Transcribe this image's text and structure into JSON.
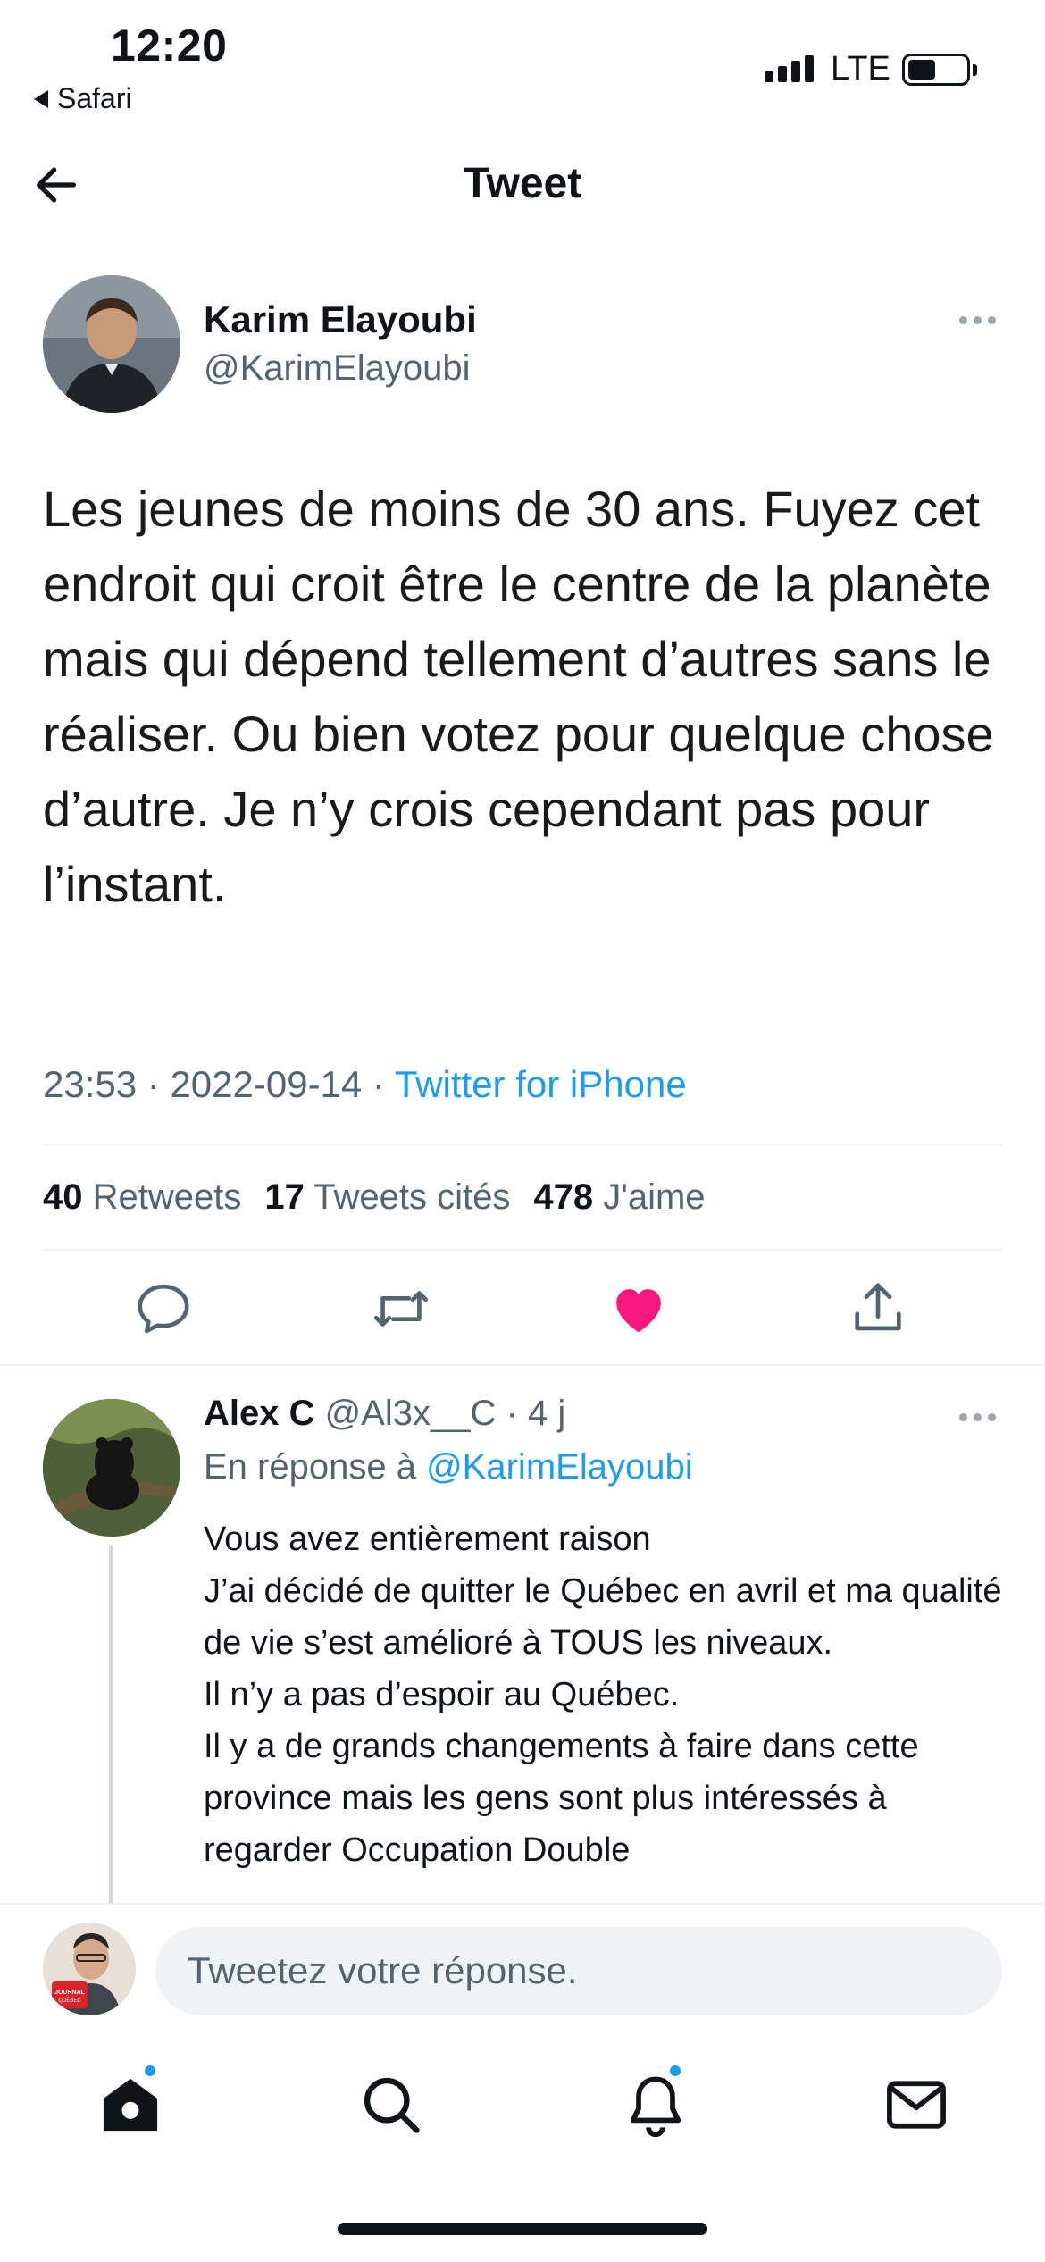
{
  "status_bar": {
    "time": "12:20",
    "back_app": "Safari",
    "network": "LTE"
  },
  "nav": {
    "title": "Tweet"
  },
  "tweet": {
    "author_name": "Karim Elayoubi",
    "author_handle": "@KarimElayoubi",
    "text": "Les jeunes de moins de 30 ans. Fuyez cet endroit qui croit être le centre de la planète mais qui dépend tellement d’autres sans le réaliser. Ou bien votez pour quelque chose d’autre. Je n’y crois cependant pas pour l’instant.",
    "time": "23:53",
    "date": "2022-09-14",
    "source": "Twitter for iPhone",
    "stats": {
      "retweets_count": "40",
      "retweets_label": "Retweets",
      "quotes_count": "17",
      "quotes_label": "Tweets cités",
      "likes_count": "478",
      "likes_label": "J'aime"
    },
    "liked": true,
    "like_color": "#f91880"
  },
  "reply": {
    "name": "Alex C",
    "handle": "@Al3x__C",
    "age": "4 j",
    "replying_to_label": "En réponse à",
    "replying_to": "@KarimElayoubi",
    "text": "Vous avez entièrement raison\nJ’ai décidé de quitter le Québec en avril et ma qualité de vie s’est amélioré à TOUS les niveaux.\nIl n’y a pas d’espoir au Québec.\nIl y a de grands changements à faire dans cette province mais les gens sont plus intéressés à regarder Occupation Double"
  },
  "composer": {
    "placeholder": "Tweetez votre réponse.",
    "avatar_text": "LE JOURNAL DE QUÉBEC"
  },
  "tab_bar": {
    "items": [
      "home-icon",
      "search-icon",
      "notifications-icon",
      "messages-icon"
    ],
    "badge_color": "#1d9bf0"
  },
  "colors": {
    "accent": "#1d9bf0",
    "secondary_text": "#536471",
    "like": "#f91880"
  }
}
